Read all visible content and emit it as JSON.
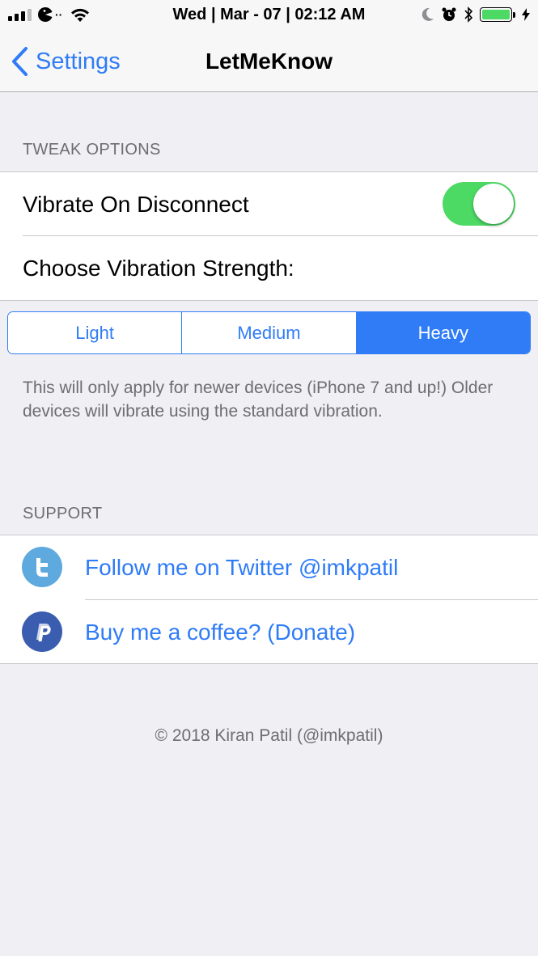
{
  "status_bar": {
    "time": "Wed | Mar - 07 | 02:12 AM",
    "battery_color": "#4cd964",
    "icons": [
      "signal-icon",
      "pacman-carrier-icon",
      "wifi-icon",
      "moon-icon",
      "alarm-icon",
      "bluetooth-icon",
      "battery-icon",
      "charging-icon"
    ]
  },
  "nav": {
    "back_label": "Settings",
    "title": "LetMeKnow"
  },
  "tweak_options": {
    "header": "TWEAK OPTIONS",
    "vibrate_label": "Vibrate On Disconnect",
    "vibrate_on": true,
    "strength_label": "Choose Vibration Strength:",
    "segments": [
      "Light",
      "Medium",
      "Heavy"
    ],
    "selected_segment": "Heavy",
    "footer": "This will only apply for newer devices (iPhone 7 and up!) Older devices will vibrate using the standard vibration."
  },
  "support": {
    "header": "SUPPORT",
    "items": [
      {
        "label": "Follow me on Twitter @imkpatil",
        "icon": "twitter-icon",
        "color": "#5ea9dd"
      },
      {
        "label": "Buy me a coffee? (Donate)",
        "icon": "paypal-icon",
        "color": "#3b5db0"
      }
    ]
  },
  "copyright": "© 2018 Kiran Patil (@imkpatil)",
  "colors": {
    "accent": "#2f7cf6",
    "toggle_on": "#4cd964",
    "background": "#efeff4"
  }
}
